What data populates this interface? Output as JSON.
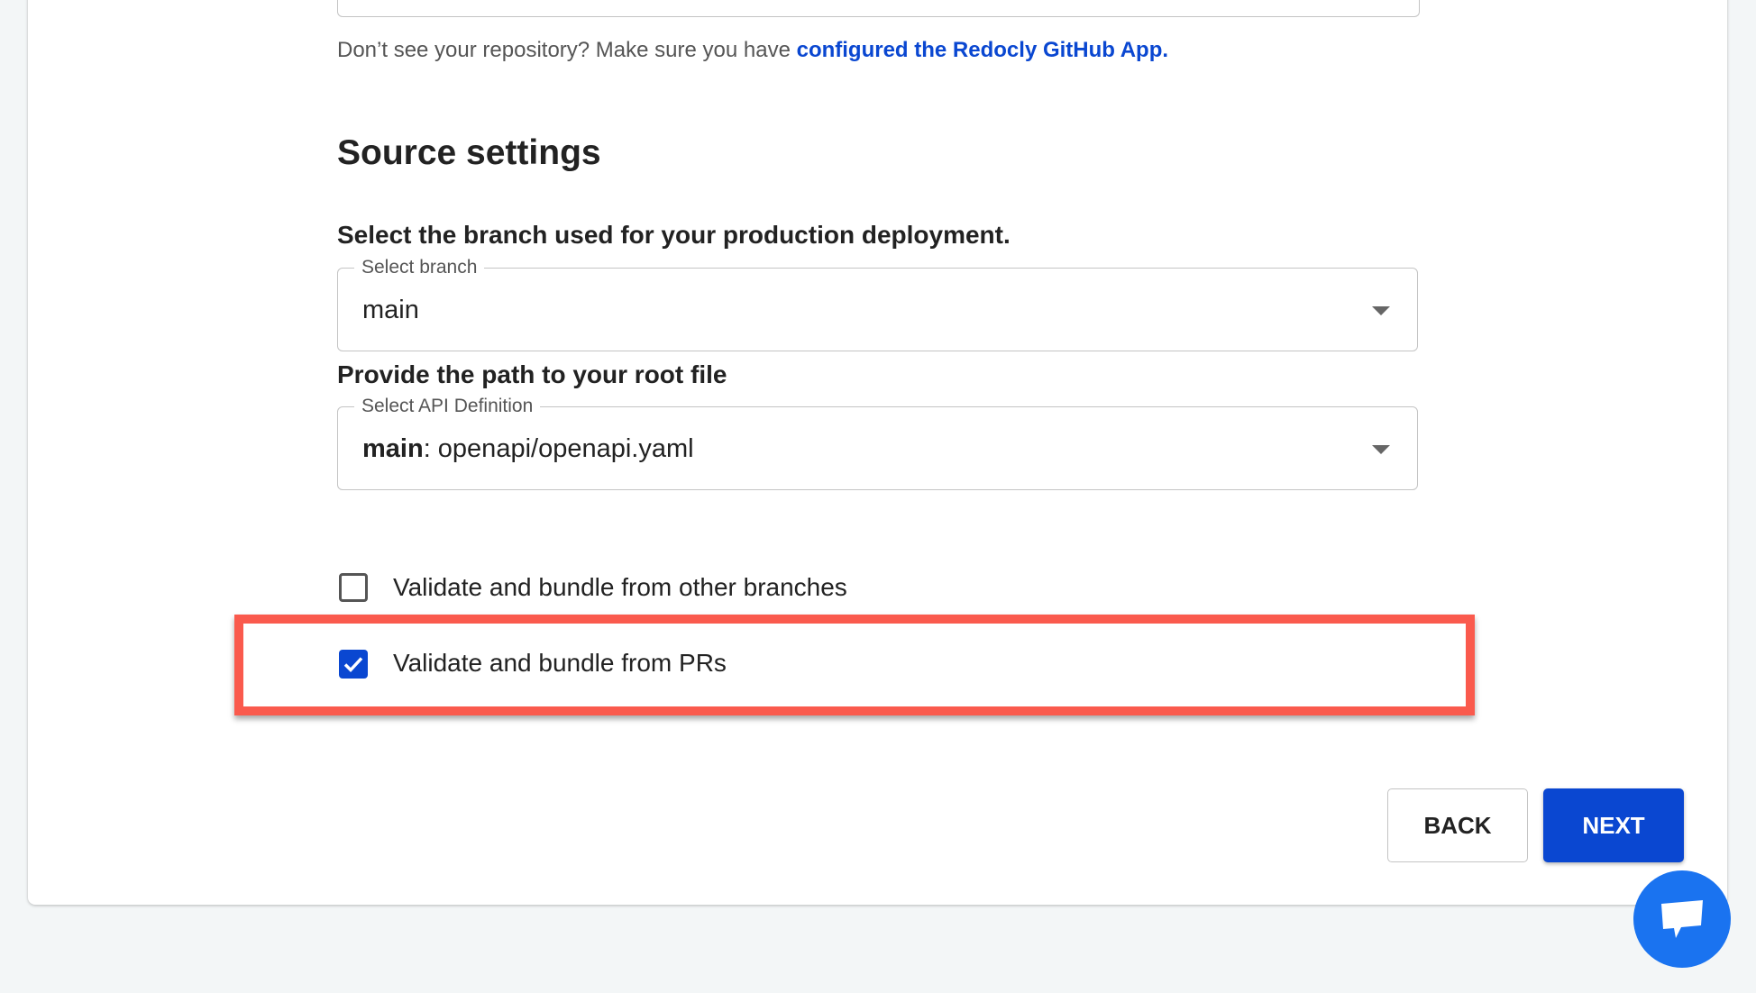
{
  "repo_help": {
    "text": "Don’t see your repository? Make sure you have ",
    "link": "configured the Redocly GitHub App."
  },
  "section_title": "Source settings",
  "branch": {
    "prompt": "Select the branch used for your production deployment.",
    "field_label": "Select branch",
    "value": "main"
  },
  "root_file": {
    "prompt": "Provide the path to your root file",
    "field_label": "Select API Definition",
    "value_branch": "main",
    "value_path": ": openapi/openapi.yaml"
  },
  "options": [
    {
      "label": "Validate and bundle from other branches",
      "checked": false
    },
    {
      "label": "Validate and bundle from PRs",
      "checked": true
    }
  ],
  "buttons": {
    "back": "BACK",
    "next": "NEXT"
  },
  "colors": {
    "accent": "#0a47d1",
    "highlight": "#fa5a4d",
    "chat": "#1a73f0"
  }
}
